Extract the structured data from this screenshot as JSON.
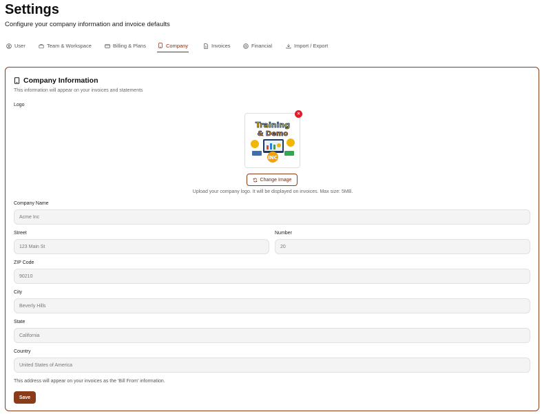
{
  "page": {
    "title": "Settings",
    "subtitle": "Configure your company information and invoice defaults"
  },
  "tabs": [
    {
      "label": "User",
      "icon": "user-circle-icon",
      "active": false
    },
    {
      "label": "Team & Workspace",
      "icon": "briefcase-icon",
      "active": false
    },
    {
      "label": "Billing & Plans",
      "icon": "credit-card-icon",
      "active": false
    },
    {
      "label": "Company",
      "icon": "tablet-icon",
      "active": true
    },
    {
      "label": "Invoices",
      "icon": "document-icon",
      "active": false
    },
    {
      "label": "Financial",
      "icon": "coin-icon",
      "active": false
    },
    {
      "label": "Import / Export",
      "icon": "download-icon",
      "active": false
    }
  ],
  "company": {
    "title": "Company Information",
    "description": "This information will appear on your invoices and statements",
    "logo_label": "Logo",
    "logo_image_text": [
      "Training",
      "& Demo",
      "INC"
    ],
    "remove_symbol": "×",
    "change_image_label": "Change Image",
    "upload_help": "Upload your company logo. It will be displayed on invoices. Max size: 5MB.",
    "fields": {
      "company_name": {
        "label": "Company Name",
        "placeholder": "Acme Inc"
      },
      "street": {
        "label": "Street",
        "placeholder": "123 Main St"
      },
      "number": {
        "label": "Number",
        "placeholder": "20"
      },
      "zip": {
        "label": "ZIP Code",
        "placeholder": "90210"
      },
      "city": {
        "label": "City",
        "placeholder": "Beverly Hills"
      },
      "state": {
        "label": "State",
        "placeholder": "California"
      },
      "country": {
        "label": "Country",
        "placeholder": "United States of America"
      }
    },
    "address_note": "This address will appear on your invoices as the 'Bill From' information.",
    "save_label": "Save"
  },
  "colors": {
    "accent": "#8a3c1a",
    "danger": "#e11d2a",
    "input_bg": "#f4f4f5"
  }
}
